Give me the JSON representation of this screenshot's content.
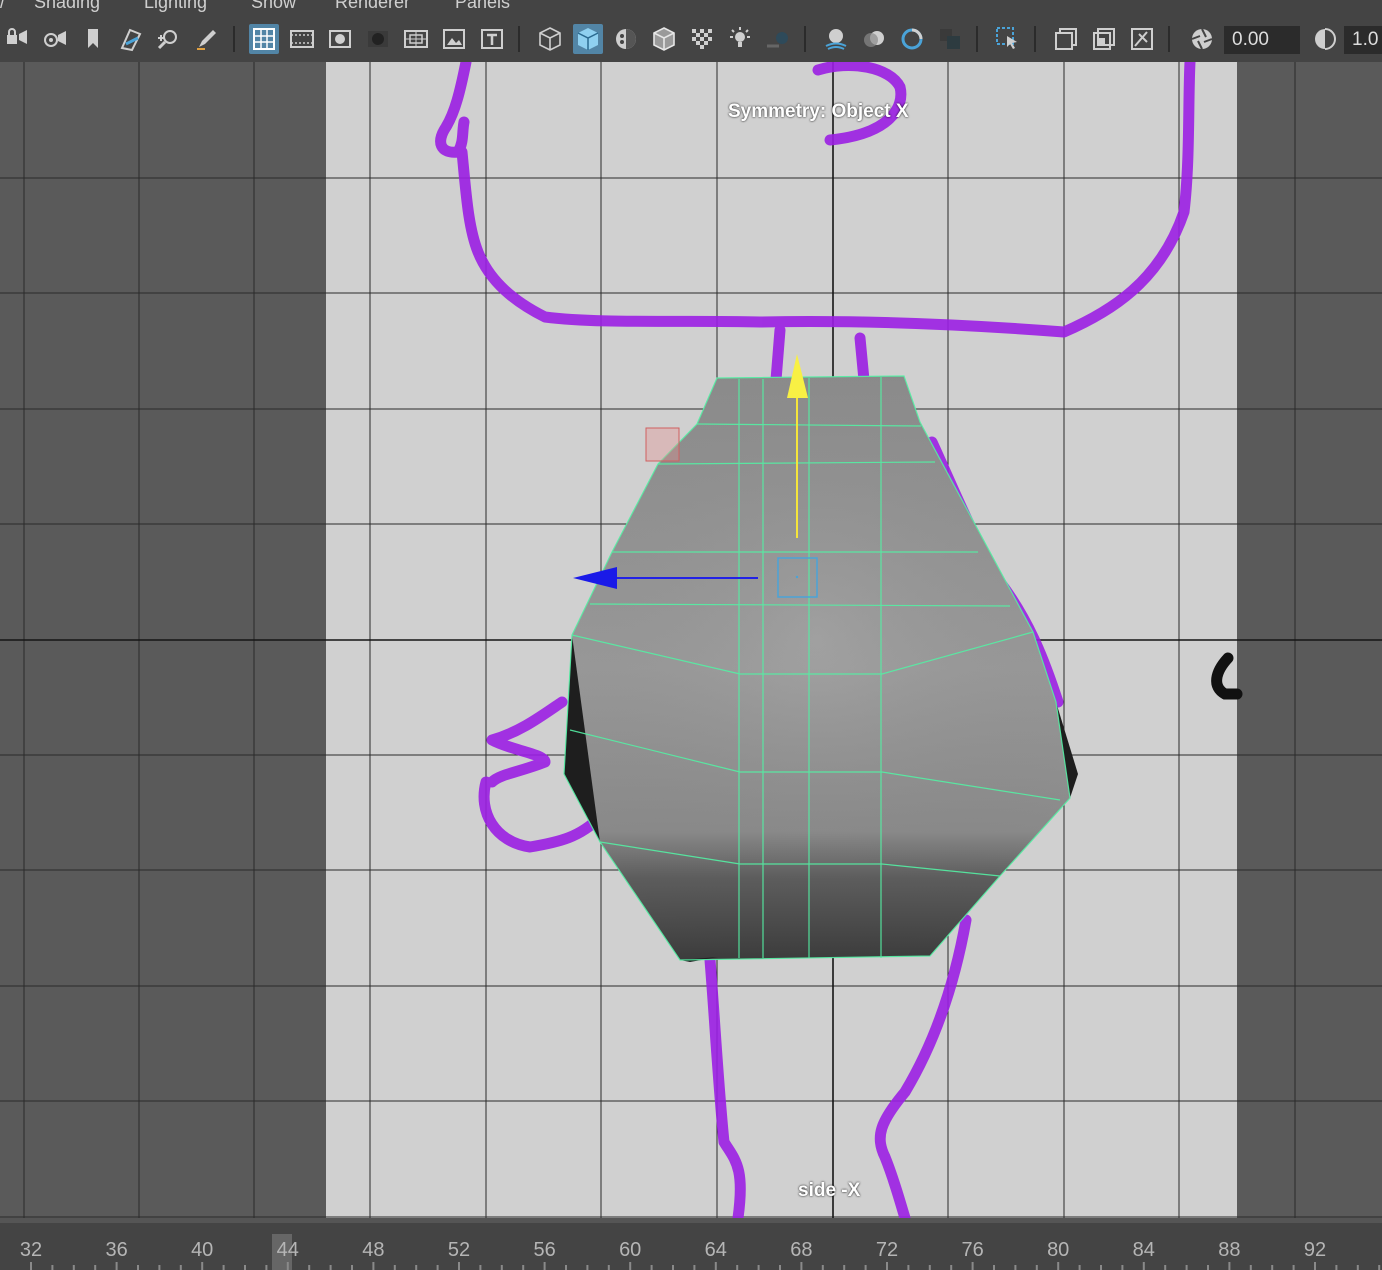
{
  "menu": {
    "items": [
      "Shading",
      "Lighting",
      "Show",
      "Renderer",
      "Panels"
    ]
  },
  "toolbar": {
    "exposure_value": "0.00",
    "gamma_value": "1.0",
    "icons": [
      "camera-lock-icon",
      "camera-attributes-icon",
      "bookmark-icon",
      "image-plane-icon",
      "2d-pan-zoom-icon",
      "grease-pencil-icon",
      "grid-icon",
      "film-gate-icon",
      "resolution-gate-icon",
      "gate-mask-icon",
      "field-chart-icon",
      "safe-action-icon",
      "safe-title-icon",
      "wireframe-icon",
      "smooth-shade-all-icon",
      "use-default-material-icon",
      "wireframe-on-shaded-icon",
      "xray-icon",
      "use-all-lights-icon",
      "shadows-icon",
      "screen-space-ao-icon",
      "motion-blur-icon",
      "multisample-aa-icon",
      "depth-of-field-icon",
      "isolate-select-icon",
      "xray-joints-icon",
      "xray-active-components-icon",
      "textured-icon",
      "camera-exposure-icon",
      "gamma-icon"
    ]
  },
  "viewport": {
    "symmetry_label": "Symmetry: Object X",
    "camera_label": "side -X",
    "wire_color": "#54f0a4",
    "sketch_color": "#9b1fe3",
    "grid_color": "#2a2a2a"
  },
  "timeline": {
    "ticks": [
      "32",
      "36",
      "40",
      "44",
      "48",
      "52",
      "56",
      "60",
      "64",
      "68",
      "72",
      "76",
      "80",
      "84",
      "88",
      "92"
    ],
    "current_frame": "44"
  }
}
